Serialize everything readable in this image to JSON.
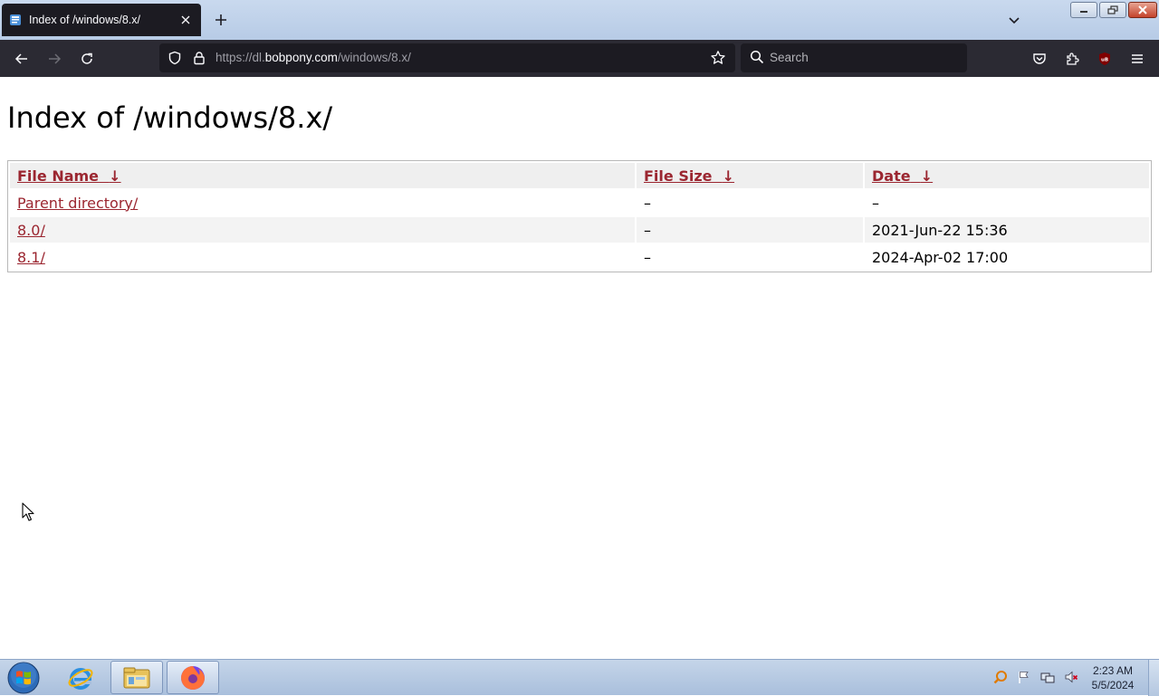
{
  "browser": {
    "tab": {
      "title": "Index of /windows/8.x/"
    },
    "url": {
      "prefix": "https://dl.",
      "host": "bobpony.com",
      "path": "/windows/8.x/"
    },
    "search": {
      "placeholder": "Search"
    },
    "extension_badge": "uB"
  },
  "page": {
    "heading": "Index of /windows/8.x/",
    "table": {
      "headers": [
        {
          "label": "File Name",
          "sort": "↓"
        },
        {
          "label": "File Size",
          "sort": "↓"
        },
        {
          "label": "Date",
          "sort": "↓"
        }
      ],
      "rows": [
        {
          "name": "Parent directory/",
          "size": "–",
          "date": "–"
        },
        {
          "name": "8.0/",
          "size": "–",
          "date": "2021-Jun-22 15:36"
        },
        {
          "name": "8.1/",
          "size": "–",
          "date": "2024-Apr-02 17:00"
        }
      ]
    }
  },
  "taskbar": {
    "time": "2:23 AM",
    "date": "5/5/2024",
    "apps": [
      "internet-explorer-icon",
      "file-explorer-icon",
      "firefox-icon"
    ]
  },
  "colors": {
    "link": "#9b2630",
    "toolbar": "#2b2a33",
    "urlbar": "#1c1b22"
  }
}
